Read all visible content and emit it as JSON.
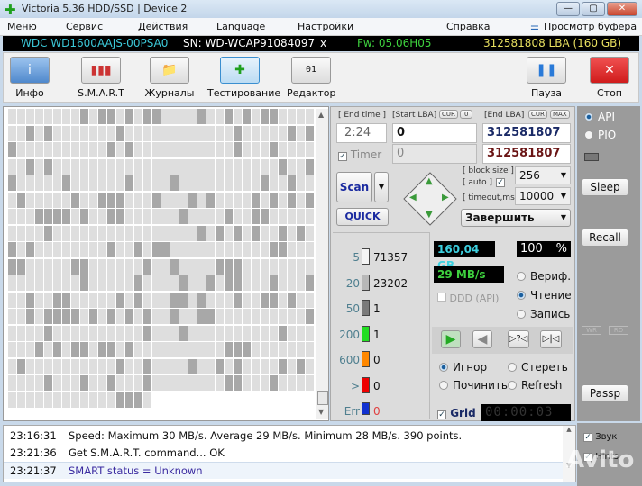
{
  "window": {
    "title": "Victoria 5.36 HDD/SSD | Device 2",
    "minimize": "—",
    "maximize": "▢",
    "close": "✕"
  },
  "menu": [
    "Меню",
    "Сервис",
    "Действия",
    "Language",
    "Настройки",
    "Справка"
  ],
  "menu_buffer": "Просмотр буфера",
  "drive": {
    "model": "WDC WD1600AAJS-00PSA0",
    "serial": "SN: WD-WCAP91084097",
    "x": "x",
    "firmware": "Fw: 05.06H05",
    "lba": "312581808 LBA (160 GB)"
  },
  "toolbar": [
    {
      "label": "Инфо",
      "icon": "i"
    },
    {
      "label": "S.M.A.R.T",
      "icon": "▮▮▮"
    },
    {
      "label": "Журналы",
      "icon": "📁"
    },
    {
      "label": "Тестирование",
      "icon": "✚"
    },
    {
      "label": "Редактор",
      "icon": "01"
    }
  ],
  "toolbar_right": [
    {
      "label": "Пауза",
      "icon": "❚❚"
    },
    {
      "label": "Стоп",
      "icon": "✕"
    }
  ],
  "controls": {
    "end_time_label": "[ End time ]",
    "end_time": "2:24",
    "start_lba_label": "[Start LBA]",
    "cur": "CUR",
    "zero": "0",
    "end_lba_label": "[End LBA]",
    "max": "MAX",
    "start_lba": "0",
    "end_lba": "312581807",
    "timer_label": "Timer",
    "timer_value": "0",
    "end_lba2": "312581807",
    "scan": "Scan",
    "quick": "QUICK",
    "block_size_label": "[ block size ]",
    "auto_label": "[ auto ]",
    "block_size": "256",
    "timeout_label": "[ timeout,ms ]",
    "timeout": "10000",
    "finish": "Завершить"
  },
  "legend": [
    {
      "n": "5",
      "v": "71357",
      "c": "#f4f4f4"
    },
    {
      "n": "20",
      "v": "23202",
      "c": "#b8b8b8"
    },
    {
      "n": "50",
      "v": "1",
      "c": "#7a7a7a"
    },
    {
      "n": "200",
      "v": "1",
      "c": "#22dd22"
    },
    {
      "n": "600",
      "v": "0",
      "c": "#ff8800"
    },
    {
      "n": ">",
      "v": "0",
      "c": "#ee0000"
    },
    {
      "n": "Err",
      "v": "0",
      "c": "#1030d0"
    }
  ],
  "status": {
    "size": "160,04 GB",
    "percent": "100",
    "pct": "%",
    "speed": "29 MB/s",
    "ddd": "DDD (API)",
    "verify": "Вериф.",
    "read": "Чтение",
    "write": "Запись"
  },
  "actions": {
    "ignore": "Игнор",
    "erase": "Стереть",
    "repair": "Починить",
    "refresh": "Refresh",
    "grid": "Grid",
    "timer": "00:00:03"
  },
  "side": {
    "api": "API",
    "pio": "PIO",
    "sleep": "Sleep",
    "recall": "Recall",
    "wr": "WR",
    "rd": "RD",
    "passp": "Passp",
    "sound": "Звук",
    "hints": "Hints"
  },
  "log": [
    {
      "time": "23:16:31",
      "msg": "Speed: Maximum 30 MB/s. Average 29 MB/s. Minimum 28 MB/s. 390 points.",
      "color": "#111"
    },
    {
      "time": "23:21:36",
      "msg": "Get S.M.A.R.T. command... OK",
      "color": "#111"
    },
    {
      "time": "23:21:37",
      "msg": "SMART status = Unknown",
      "color": "#3a2aa0"
    }
  ],
  "watermark": "Avito"
}
